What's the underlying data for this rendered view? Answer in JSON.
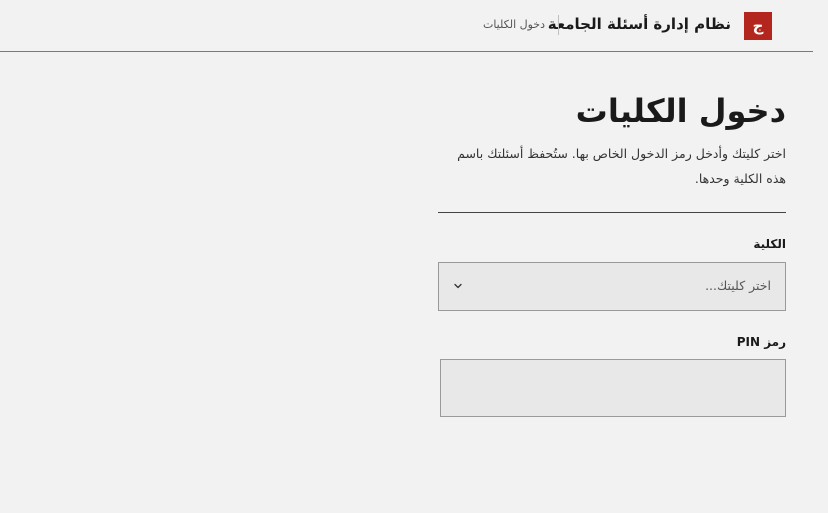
{
  "header": {
    "logo_letter": "ج",
    "app_title": "نظام إدارة أسئلة الجامعة",
    "breadcrumb": "دخول الكليات"
  },
  "main": {
    "title": "دخول الكليات",
    "subtitle": "اختر كليتك وأدخل رمز الدخول الخاص بها. ستُحفظ أسئلتك باسم هذه الكلية وحدها.",
    "college_field": {
      "label": "الكلية",
      "placeholder": "اختر كليتك..."
    },
    "pin_field": {
      "label": "رمز PIN",
      "value": ""
    }
  },
  "colors": {
    "brand": "#b3261e",
    "background": "#f2f2f2",
    "field_background": "#e8e8e8"
  },
  "icons": {
    "select_arrow": "chevron-down-icon"
  }
}
